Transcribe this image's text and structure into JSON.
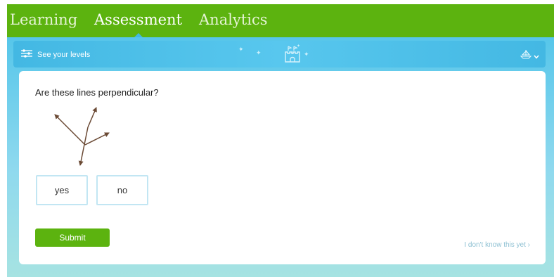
{
  "nav": {
    "tabs": [
      {
        "label": "Learning"
      },
      {
        "label": "Assessment"
      },
      {
        "label": "Analytics"
      }
    ],
    "active": "Assessment"
  },
  "levels_bar": {
    "link_label": "See your levels",
    "icon": "sliders-icon",
    "center_icon": "castle-icon",
    "menu_icon": "ship-icon"
  },
  "question": {
    "prompt": "Are these lines perpendicular?",
    "choices": [
      {
        "label": "yes"
      },
      {
        "label": "no"
      }
    ],
    "submit_label": "Submit",
    "skip_label": "I don't know this yet ›"
  },
  "colors": {
    "nav_green": "#5cb30f",
    "bar_blue": "#43b8e3",
    "line_brown": "#6b4a35"
  }
}
